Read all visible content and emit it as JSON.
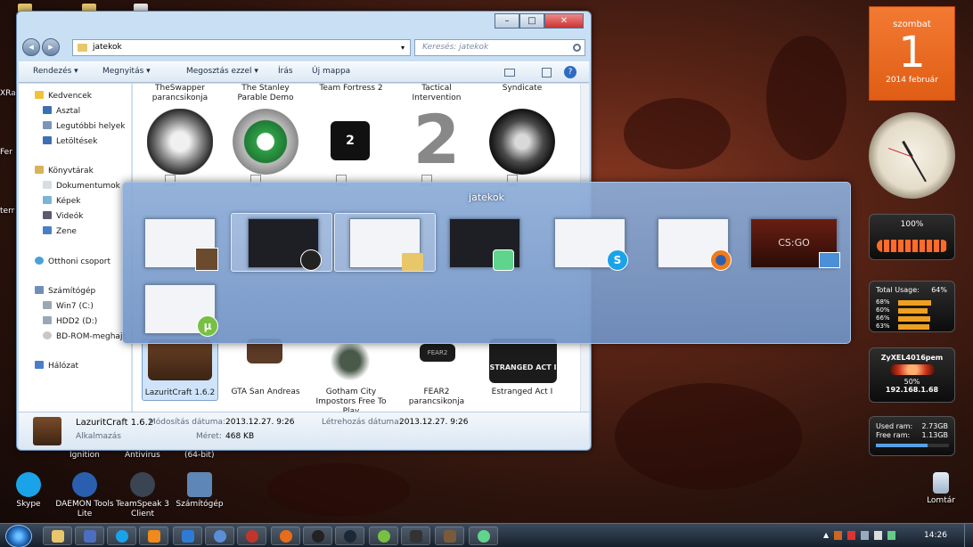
{
  "explorer": {
    "window_buttons": [
      "–",
      "□",
      "✕"
    ],
    "address": "jatekok",
    "search_placeholder": "Keresés: jatekok",
    "toolbar": [
      "Rendezés ▾",
      "Megnyitás ▾",
      "Megosztás ezzel ▾",
      "Írás",
      "Új mappa"
    ],
    "nav": {
      "favorites_header": "Kedvencek",
      "favorites": [
        "Asztal",
        "Legutóbbi helyek",
        "Letöltések"
      ],
      "libraries_header": "Könyvtárak",
      "libraries": [
        "Dokumentumok",
        "Képek",
        "Videók",
        "Zene"
      ],
      "homegroup": "Otthoni csoport",
      "computer_header": "Számítógép",
      "drives": [
        "Win7 (C:)",
        "HDD2 (D:)",
        "BD-ROM-meghajt"
      ],
      "network": "Hálózat"
    },
    "files_top": [
      "TheSwapper parancsikonja",
      "The Stanley Parable Demo",
      "Team Fortress 2",
      "Tactical Intervention",
      "Syndicate"
    ],
    "files_bottom": [
      "LazuritCraft 1.6.2",
      "GTA San Andreas",
      "Gotham City Impostors Free To Play",
      "FEAR2 parancsikonja",
      "Estranged Act I"
    ],
    "tf2_glyph": "2",
    "fear_glyph": "FEAR2",
    "estranged_glyph": "STRANGED ACT I",
    "details": {
      "name": "LazuritCraft 1.6.2",
      "type": "Alkalmazás",
      "modified_label": "Módosítás dátuma:",
      "modified_value": "2013.12.27. 9:26",
      "size_label": "Méret:",
      "size_value": "468 KB",
      "created_label": "Létrehozás dátuma:",
      "created_value": "2013.12.27. 9:26"
    }
  },
  "switcher": {
    "title": "jatekok",
    "badges": {
      "skype": "S",
      "utorrent": "µ"
    },
    "csgo_text": "CS:GO"
  },
  "desktop": {
    "top_left_labels": [
      "XRa",
      "Fer",
      "terr"
    ],
    "partial_labels": [
      "Ignition",
      "Antivirus",
      "(64-bit)"
    ],
    "icons": [
      {
        "label": "Skype",
        "color": "#1aa3e8"
      },
      {
        "label": "DAEMON Tools Lite",
        "color": "#2a5fb0"
      },
      {
        "label": "TeamSpeak 3 Client",
        "color": "#3a4452"
      },
      {
        "label": "Számítógép",
        "color": "#5e86b6"
      }
    ],
    "recycle_bin": "Lomtár"
  },
  "gadgets": {
    "calendar": {
      "day_name": "szombat",
      "day": "1",
      "month": "2014 február"
    },
    "battery": {
      "label": "100%",
      "level": 1.0
    },
    "cpu": {
      "label": "Total Usage:",
      "value": "64%",
      "cores": [
        "68%",
        "60%",
        "66%",
        "63%"
      ],
      "levels": [
        0.68,
        0.6,
        0.66,
        0.63
      ]
    },
    "network": {
      "name": "ZyXEL4016pem",
      "signal": "50%",
      "ip": "192.168.1.68"
    },
    "ram": {
      "used_label": "Used ram:",
      "used_value": "2.73GB",
      "free_label": "Free ram:",
      "free_value": "1.13GB",
      "level": 0.71
    }
  },
  "taskbar": {
    "time": "14:26"
  }
}
